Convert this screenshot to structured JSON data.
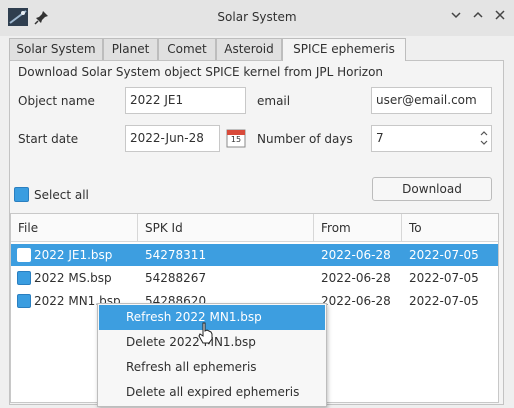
{
  "window": {
    "title": "Solar System"
  },
  "tabs": [
    {
      "label": "Solar System"
    },
    {
      "label": "Planet"
    },
    {
      "label": "Comet"
    },
    {
      "label": "Asteroid"
    },
    {
      "label": "SPICE ephemeris"
    }
  ],
  "form": {
    "header": "Download Solar System object SPICE kernel from JPL Horizon",
    "object_name_label": "Object name",
    "object_name_value": "2022 JE1",
    "email_label": "email",
    "email_value": "user@email.com",
    "start_date_label": "Start date",
    "start_date_value": "2022-Jun-28",
    "calendar_day": "15",
    "num_days_label": "Number of days",
    "num_days_value": "7",
    "select_all_label": "Select all",
    "download_label": "Download"
  },
  "table": {
    "columns": [
      "File",
      "SPK Id",
      "From",
      "To"
    ],
    "rows": [
      {
        "file": "2022 JE1.bsp",
        "spk": "54278311",
        "from": "2022-06-28",
        "to": "2022-07-05"
      },
      {
        "file": "2022 MS.bsp",
        "spk": "54288267",
        "from": "2022-06-28",
        "to": "2022-07-05"
      },
      {
        "file": "2022 MN1.bsp",
        "spk": "54288620",
        "from": "2022-06-28",
        "to": "2022-07-05"
      }
    ]
  },
  "context_menu": {
    "items": [
      {
        "label": "Refresh 2022 MN1.bsp"
      },
      {
        "label": "Delete 2022 MN1.bsp"
      },
      {
        "label": "Refresh all ephemeris"
      },
      {
        "label": "Delete all expired ephemeris"
      }
    ]
  },
  "colors": {
    "accent": "#3d9ee0",
    "window_bg": "#efefef"
  }
}
